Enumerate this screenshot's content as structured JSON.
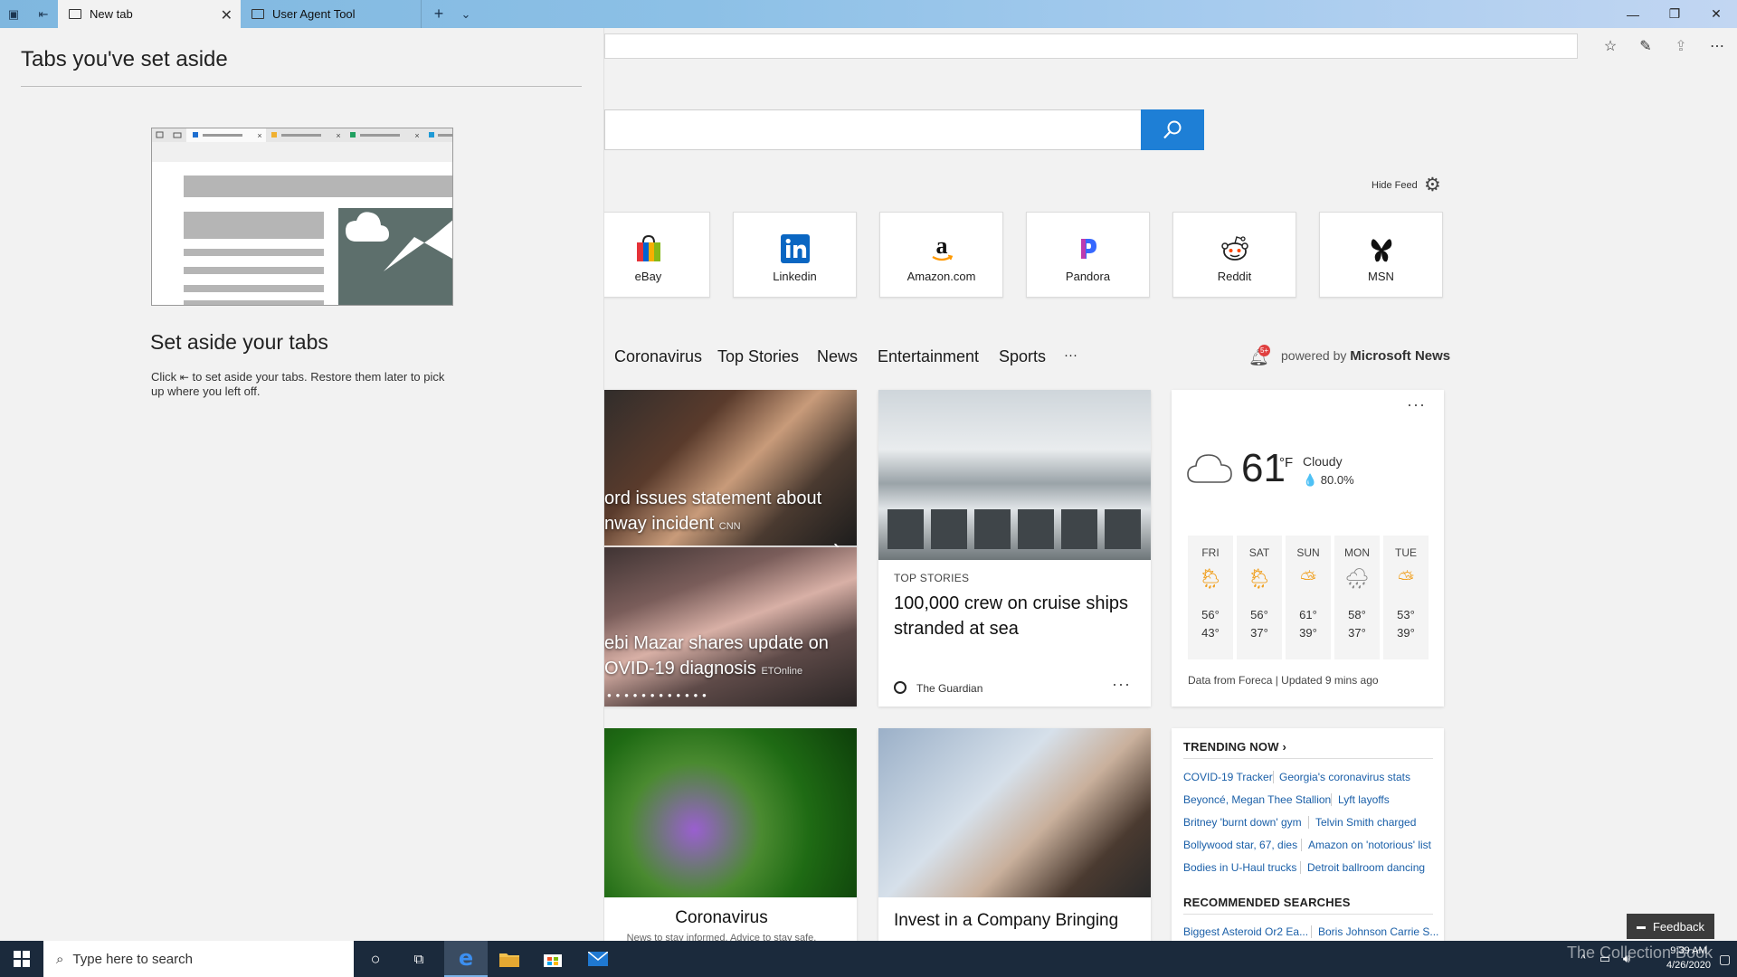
{
  "tabs": [
    {
      "label": "New tab",
      "active": true
    },
    {
      "label": "User Agent Tool",
      "active": false
    }
  ],
  "window_controls": {
    "minimize": "—",
    "restore": "❐",
    "close": "✕"
  },
  "search": {
    "button_icon": "search-icon"
  },
  "feed": {
    "hide_label": "Hide Feed"
  },
  "top_sites": [
    {
      "name": "eBay",
      "icon": "ebay-bag-icon"
    },
    {
      "name": "Linkedin",
      "icon": "linkedin-icon"
    },
    {
      "name": "Amazon.com",
      "icon": "amazon-icon"
    },
    {
      "name": "Pandora",
      "icon": "pandora-icon"
    },
    {
      "name": "Reddit",
      "icon": "reddit-icon"
    },
    {
      "name": "MSN",
      "icon": "msn-butterfly-icon"
    }
  ],
  "news_nav": {
    "items": [
      "Coronavirus",
      "Top Stories",
      "News",
      "Entertainment",
      "Sports",
      "···"
    ],
    "badge": "5+",
    "powered_prefix": "powered by",
    "powered_brand": "Microsoft News"
  },
  "carousel": {
    "story1_line1": "ord issues statement about",
    "story1_line2": "nway incident",
    "story1_source": "CNN",
    "story2_line1": "ebi Mazar shares update on",
    "story2_line2": "OVID-19 diagnosis",
    "story2_source": "ETOnline",
    "dots": "••••••••••••••",
    "next_icon": "chevron-right-icon"
  },
  "top_story": {
    "tag": "TOP STORIES",
    "headline": "100,000 crew on cruise ships stranded at sea",
    "source": "The Guardian",
    "more": "···"
  },
  "weather": {
    "temp": "61",
    "unit": "°F",
    "condition": "Cloudy",
    "humidity": "💧 80.0%",
    "more": "···",
    "days": [
      {
        "name": "FRI",
        "hi": "56°",
        "lo": "43°"
      },
      {
        "name": "SAT",
        "hi": "56°",
        "lo": "37°"
      },
      {
        "name": "SUN",
        "hi": "61°",
        "lo": "39°"
      },
      {
        "name": "MON",
        "hi": "58°",
        "lo": "37°"
      },
      {
        "name": "TUE",
        "hi": "53°",
        "lo": "39°"
      }
    ],
    "footer": "Data from Foreca | Updated 9 mins ago"
  },
  "bottom_cards": {
    "coronavirus_title": "Coronavirus",
    "coronavirus_sub": "News to stay informed. Advice to stay safe.",
    "invest_title": "Invest in a Company Bringing"
  },
  "trending": {
    "title": "TRENDING NOW ›",
    "items": [
      [
        "COVID-19 Tracker",
        "Georgia's coronavirus stats"
      ],
      [
        "Beyoncé, Megan Thee Stallion",
        "Lyft layoffs"
      ],
      [
        "Britney 'burnt down' gym",
        "Telvin Smith charged"
      ],
      [
        "Bollywood star, 67, dies",
        "Amazon on 'notorious' list"
      ],
      [
        "Bodies in U-Haul trucks",
        "Detroit ballroom dancing"
      ]
    ],
    "rec_title": "RECOMMENDED SEARCHES",
    "rec_items": [
      "Biggest Asteroid Or2 Ea...",
      "Boris Johnson Carrie S..."
    ]
  },
  "feedback": {
    "label": "Feedback"
  },
  "aside": {
    "title": "Tabs you've set aside",
    "subtitle": "Set aside your tabs",
    "desc_before": "Click",
    "desc_after": "to set aside your tabs. Restore them later to pick up where you left off."
  },
  "taskbar": {
    "search_placeholder": "Type here to search",
    "time": "9:39 AM",
    "date": "4/26/2020",
    "watermark": "The Collection Book"
  },
  "colors": {
    "accent": "#1e7fd6",
    "titlebar": "#8cc0e6",
    "taskbar": "#1b2a3c"
  }
}
